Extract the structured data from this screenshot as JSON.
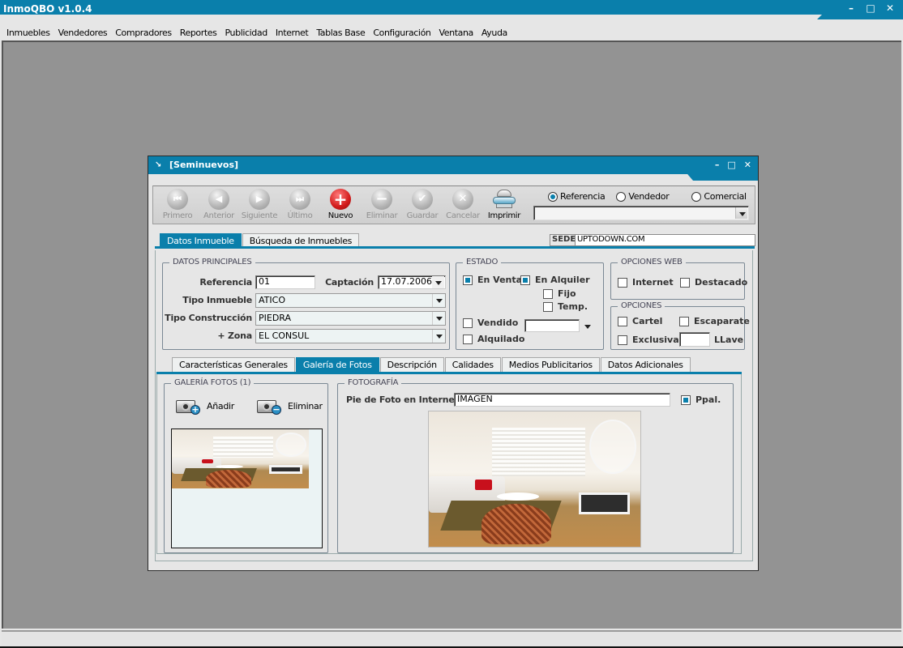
{
  "app": {
    "title": "InmoQBO v1.0.4",
    "window_controls": {
      "minimize": "–",
      "maximize": "□",
      "close": "✕"
    }
  },
  "menu": {
    "items": [
      "Inmuebles",
      "Vendedores",
      "Compradores",
      "Reportes",
      "Publicidad",
      "Internet",
      "Tablas Base",
      "Configuración",
      "Ventana",
      "Ayuda"
    ]
  },
  "child_window": {
    "title": "[Seminuevos]",
    "icon": "restore-arrow-icon",
    "controls": {
      "minimize": "–",
      "maximize": "□",
      "close": "✕"
    }
  },
  "toolbar": {
    "buttons": [
      {
        "label": "Primero",
        "icon": "first-record-icon",
        "glyph": "⏮",
        "enabled": false
      },
      {
        "label": "Anterior",
        "icon": "previous-record-icon",
        "glyph": "◀",
        "enabled": false
      },
      {
        "label": "Siguiente",
        "icon": "next-record-icon",
        "glyph": "▶",
        "enabled": false
      },
      {
        "label": "Último",
        "icon": "last-record-icon",
        "glyph": "⏭",
        "enabled": false
      },
      {
        "label": "Nuevo",
        "icon": "add-icon",
        "glyph": "+",
        "enabled": true
      },
      {
        "label": "Eliminar",
        "icon": "remove-icon",
        "glyph": "−",
        "enabled": false
      },
      {
        "label": "Guardar",
        "icon": "check-icon",
        "glyph": "✔",
        "enabled": false
      },
      {
        "label": "Cancelar",
        "icon": "cancel-icon",
        "glyph": "✕",
        "enabled": false
      },
      {
        "label": "Imprimir",
        "icon": "printer-icon",
        "glyph": "",
        "enabled": true
      }
    ],
    "search_mode": {
      "options": [
        "Referencia",
        "Vendedor",
        "Comercial"
      ],
      "selected": "Referencia"
    },
    "search_combo_value": ""
  },
  "main_tabs": {
    "items": [
      "Datos Inmueble",
      "Búsqueda de Inmuebles"
    ],
    "active": "Datos Inmueble"
  },
  "sede": {
    "label": "SEDE",
    "value": "UPTODOWN.COM"
  },
  "datos_principales": {
    "title": "DATOS PRINCIPALES",
    "referencia_label": "Referencia",
    "referencia_value": "01",
    "captacion_label": "Captación",
    "captacion_value": "17.07.2006",
    "tipo_inmueble_label": "Tipo Inmueble",
    "tipo_inmueble_value": "ATICO",
    "tipo_construccion_label": "Tipo Construcción",
    "tipo_construccion_value": "PIEDRA",
    "zona_label": "+ Zona",
    "zona_value": "EL CONSUL"
  },
  "estado": {
    "title": "ESTADO",
    "en_venta": {
      "label": "En Venta",
      "checked": true
    },
    "en_alquiler": {
      "label": "En Alquiler",
      "checked": true
    },
    "fijo": {
      "label": "Fijo",
      "checked": false
    },
    "temp": {
      "label": "Temp.",
      "checked": false
    },
    "vendido": {
      "label": "Vendido",
      "checked": false
    },
    "alquilado": {
      "label": "Alquilado",
      "checked": false
    },
    "date_combo_value": ""
  },
  "opciones_web": {
    "title": "OPCIONES WEB",
    "internet": {
      "label": "Internet",
      "checked": false
    },
    "destacado": {
      "label": "Destacado",
      "checked": false
    }
  },
  "opciones": {
    "title": "OPCIONES",
    "cartel": {
      "label": "Cartel",
      "checked": false
    },
    "escaparate": {
      "label": "Escaparate",
      "checked": false
    },
    "exclusiva": {
      "label": "Exclusiva",
      "checked": false
    },
    "llave_label": "LLave",
    "llave_value": ""
  },
  "sub_tabs": {
    "items": [
      "Características Generales",
      "Galería de Fotos",
      "Descripción",
      "Calidades",
      "Medios Publicitarios",
      "Datos Adicionales"
    ],
    "active": "Galería de Fotos"
  },
  "galeria": {
    "title": "GALERÍA FOTOS (1)",
    "add_label": "Añadir",
    "remove_label": "Eliminar",
    "thumbnail_alt": "living room photo thumbnail"
  },
  "fotografia": {
    "title": "FOTOGRAFÍA",
    "caption_label": "Pie de Foto en Internet",
    "caption_value": "IMAGEN",
    "ppal": {
      "label": "Ppal.",
      "checked": true
    },
    "photo_alt": "living room with white sofa, red pillow and wicker chair"
  },
  "colors": {
    "accent": "#0a7fab",
    "workspace": "#939393",
    "nuevo_red": "#d21b1b"
  }
}
